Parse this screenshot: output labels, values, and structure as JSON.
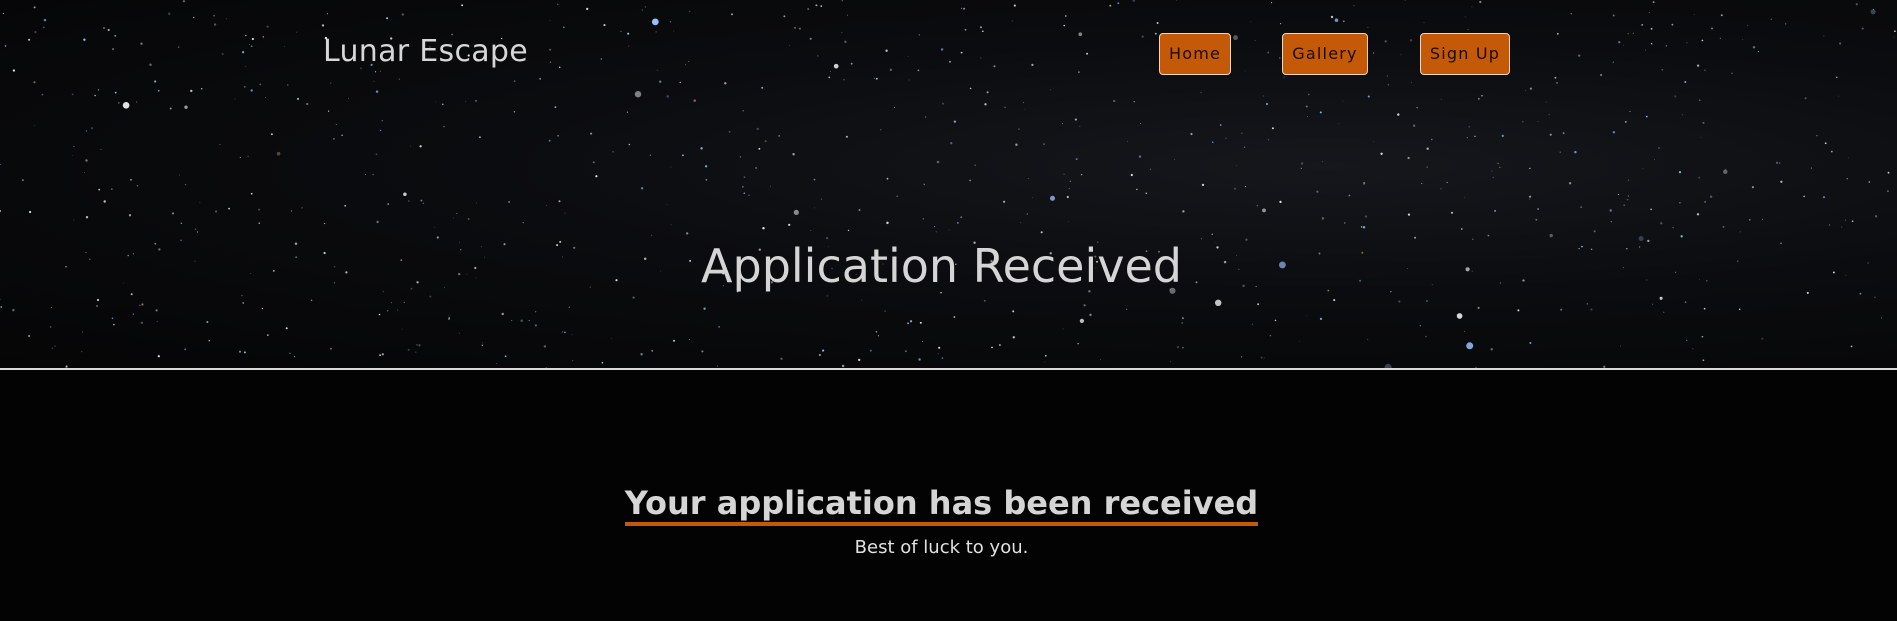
{
  "site": {
    "name": "Lunar Escape"
  },
  "navigation": {
    "items": [
      {
        "label": "Home"
      },
      {
        "label": "Gallery"
      },
      {
        "label": "Sign Up"
      }
    ]
  },
  "hero": {
    "title": "Application Received",
    "background": "starfield"
  },
  "confirmation": {
    "heading": "Your application has been received",
    "message": "Best of luck to you."
  },
  "colors": {
    "accent": "#c45a08",
    "text": "#d5d5d5",
    "background": "#030303"
  }
}
